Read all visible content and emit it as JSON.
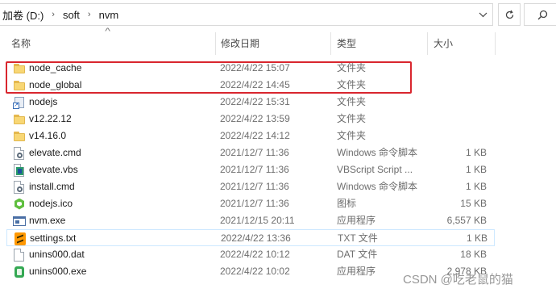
{
  "address_bar": {
    "crumbs": [
      "加卷 (D:)",
      "soft",
      "nvm"
    ]
  },
  "columns": {
    "name": "名称",
    "date_modified": "修改日期",
    "type": "类型",
    "size": "大小"
  },
  "files": [
    {
      "name": "node_cache",
      "date": "2022/4/22 15:07",
      "type": "文件夹",
      "size": "",
      "icon": "folder-icon"
    },
    {
      "name": "node_global",
      "date": "2022/4/22 14:45",
      "type": "文件夹",
      "size": "",
      "icon": "folder-icon"
    },
    {
      "name": "nodejs",
      "date": "2022/4/22 15:31",
      "type": "文件夹",
      "size": "",
      "icon": "folder-shortcut-icon"
    },
    {
      "name": "v12.22.12",
      "date": "2022/4/22 13:59",
      "type": "文件夹",
      "size": "",
      "icon": "folder-icon"
    },
    {
      "name": "v14.16.0",
      "date": "2022/4/22 14:12",
      "type": "文件夹",
      "size": "",
      "icon": "folder-icon"
    },
    {
      "name": "elevate.cmd",
      "date": "2021/12/7 11:36",
      "type": "Windows 命令脚本",
      "size": "1 KB",
      "icon": "cmd-script-icon"
    },
    {
      "name": "elevate.vbs",
      "date": "2021/12/7 11:36",
      "type": "VBScript Script ...",
      "size": "1 KB",
      "icon": "vbs-script-icon"
    },
    {
      "name": "install.cmd",
      "date": "2021/12/7 11:36",
      "type": "Windows 命令脚本",
      "size": "1 KB",
      "icon": "cmd-script-icon"
    },
    {
      "name": "nodejs.ico",
      "date": "2021/12/7 11:36",
      "type": "图标",
      "size": "15 KB",
      "icon": "nodejs-ico-icon"
    },
    {
      "name": "nvm.exe",
      "date": "2021/12/15 20:11",
      "type": "应用程序",
      "size": "6,557 KB",
      "icon": "exe-icon"
    },
    {
      "name": "settings.txt",
      "date": "2022/4/22 13:36",
      "type": "TXT 文件",
      "size": "1 KB",
      "icon": "sublime-text-icon"
    },
    {
      "name": "unins000.dat",
      "date": "2022/4/22 10:12",
      "type": "DAT 文件",
      "size": "18 KB",
      "icon": "dat-file-icon"
    },
    {
      "name": "unins000.exe",
      "date": "2022/4/22 10:02",
      "type": "应用程序",
      "size": "2,978 KB",
      "icon": "installer-icon"
    }
  ],
  "highlight_color": "#d9262e",
  "hover_color": "#cde8ff",
  "watermark": "CSDN @吃老鼠的猫"
}
